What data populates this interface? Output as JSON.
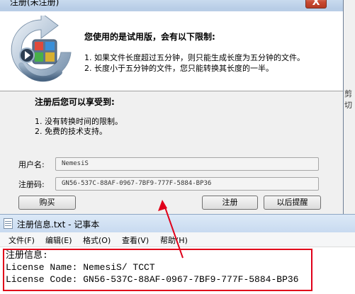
{
  "dialog": {
    "title": "注册(未注册)",
    "close_label": "X",
    "banner_heading": "您使用的是试用版，会有以下限制:",
    "limits": [
      "1. 如果文件长度超过五分钟，则只能生成长度为五分钟的文件。",
      "2. 长度小于五分钟的文件，您只能转换其长度的一半。"
    ],
    "benefits_heading": "注册后您可以享受到:",
    "benefits": [
      "1. 没有转换时间的限制。",
      "2. 免费的技术支持。"
    ],
    "username_label": "用户名:",
    "username_value": "NemesiS",
    "code_label": "注册码:",
    "code_value": "GN56-537C-88AF-0967-7BF9-777F-5884-BP36",
    "buy_label": "购买",
    "register_label": "注册",
    "remind_label": "以后提醒"
  },
  "background_text": "剪切",
  "notepad": {
    "title": "注册信息.txt - 记事本",
    "menu": [
      "文件(F)",
      "编辑(E)",
      "格式(O)",
      "查看(V)",
      "帮助(H)"
    ],
    "lines": [
      "注册信息:",
      "License Name: NemesiS/ TCCT",
      "License Code: GN56-537C-88AF-0967-7BF9-777F-5884-BP36"
    ]
  },
  "colors": {
    "annotation": "#e0001a",
    "titlebar": "#c8daf0"
  }
}
